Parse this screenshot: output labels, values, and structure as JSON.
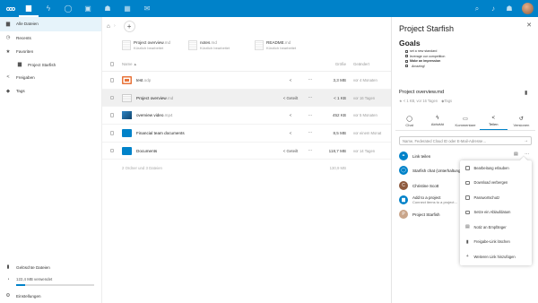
{
  "topbar": {
    "apps": [
      {
        "icon": "files-icon",
        "glyph": "▆"
      },
      {
        "icon": "activity-icon",
        "glyph": "ϟ"
      },
      {
        "icon": "talk-icon",
        "glyph": "◯"
      },
      {
        "icon": "photos-icon",
        "glyph": "▣"
      },
      {
        "icon": "contacts-icon",
        "glyph": "☗"
      },
      {
        "icon": "calendar-icon",
        "glyph": "▦"
      },
      {
        "icon": "mail-icon",
        "glyph": "✉"
      }
    ]
  },
  "sidebar": {
    "items": [
      {
        "label": "Alle Dateien",
        "glyph": "▆"
      },
      {
        "label": "Recents",
        "glyph": "◷"
      },
      {
        "label": "Favoriten",
        "glyph": "★"
      },
      {
        "label": "Project Starfish",
        "glyph": "▆"
      },
      {
        "label": "Freigaben",
        "glyph": "<"
      },
      {
        "label": "Tags",
        "glyph": "◆"
      }
    ],
    "deleted": "Gelöschte Dateien",
    "quota": "122,4 MB verwendet",
    "quota_fraction": 0.12,
    "settings": "Einstellungen"
  },
  "main": {
    "recent": [
      {
        "name": "Project overview",
        "ext": ".md",
        "sub": "Kürzlich bearbeitet"
      },
      {
        "name": "notes",
        "ext": ".md",
        "sub": "Kürzlich bearbeitet"
      },
      {
        "name": "README",
        "ext": ".md",
        "sub": "Kürzlich bearbeitet"
      }
    ],
    "columns": {
      "name": "Name ▲",
      "size": "Größe",
      "modified": "Geändert"
    },
    "files": [
      {
        "name": "test",
        "ext": ".odp",
        "share": "",
        "size": "3,3 MB",
        "modified": "vor 4 Monaten",
        "color": "#e8743b",
        "icon": "presentation-icon"
      },
      {
        "name": "Project overview",
        "ext": ".md",
        "share": "Geteilt",
        "size": "< 1 KB",
        "modified": "vor 16 Tagen",
        "color": "#dddddd",
        "icon": "text-file-icon"
      },
      {
        "name": "overview video",
        "ext": ".mp4",
        "share": "",
        "size": "452 KB",
        "modified": "vor 5 Monaten",
        "color": "#1f6fa8",
        "icon": "video-file-icon"
      },
      {
        "name": "Financial team documents",
        "ext": "",
        "share": "",
        "size": "8,5 MB",
        "modified": "vor einem Monat",
        "color": "#0082c9",
        "icon": "shared-folder-icon"
      },
      {
        "name": "Documents",
        "ext": "",
        "share": "Geteilt",
        "size": "118,7 MB",
        "modified": "vor 14 Tagen",
        "color": "#0082c9",
        "icon": "link-folder-icon"
      }
    ],
    "summary": {
      "count": "2 Ordner und 3 Dateien",
      "total": "130,9 MB"
    }
  },
  "panel": {
    "title": "Project Starfish",
    "goals_heading": "Goals",
    "goals": [
      "set a new standard",
      "leverage our competition",
      "Make an impression",
      "  Amazing!"
    ],
    "file_name": "Project overview.md",
    "file_meta": "< 1 KB, vor 16 Tagen",
    "tags": "Tags",
    "tabs": [
      {
        "label": "Chat",
        "glyph": "◯"
      },
      {
        "label": "Aktivität",
        "glyph": "ϟ"
      },
      {
        "label": "Kommentare",
        "glyph": "▭"
      },
      {
        "label": "Teilen",
        "glyph": "<"
      },
      {
        "label": "Versionen",
        "glyph": "↺"
      }
    ],
    "share_placeholder": "Name, Federated Cloud ID oder E-Mail-Adresse…",
    "link_label": "Link teilen",
    "shares": [
      {
        "name": "Starfish chat (Unterhaltung)",
        "color": "#0082c9",
        "glyph": "◯"
      },
      {
        "name": "Christine Scott",
        "color": "#8e5a3e",
        "glyph": "C"
      },
      {
        "name": "Add to a project",
        "sub": "Connect items to a project…",
        "color": "#0082c9",
        "glyph": "▆"
      },
      {
        "name": "Project Starfish",
        "color": "#c9a58a",
        "glyph": "P"
      }
    ],
    "menu": [
      "Bearbeitung erlauben",
      "Download verbergen",
      "Passwortschutz",
      "Setze ein Ablaufdatum",
      "Notiz an Empfänger",
      "Freigabe-Link löschen",
      "Weiteren Link hinzufügen"
    ]
  }
}
